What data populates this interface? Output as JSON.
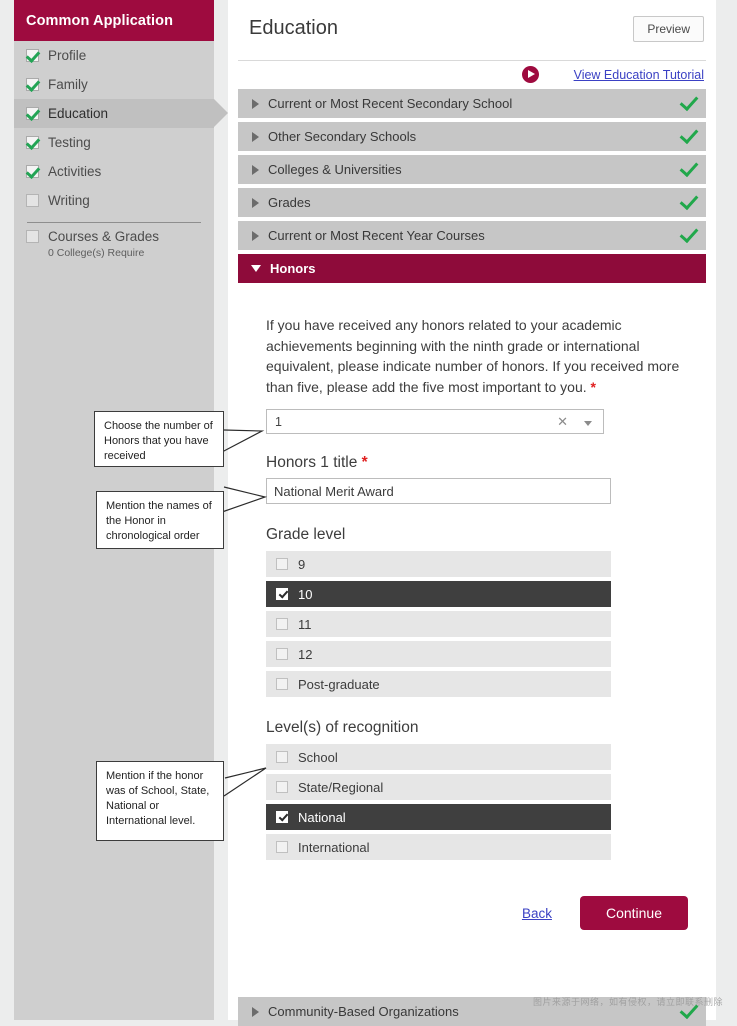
{
  "sidebar": {
    "brand": "Common Application",
    "items": [
      {
        "label": "Profile",
        "checked": true
      },
      {
        "label": "Family",
        "checked": true
      },
      {
        "label": "Education",
        "checked": true,
        "active": true
      },
      {
        "label": "Testing",
        "checked": true
      },
      {
        "label": "Activities",
        "checked": true
      },
      {
        "label": "Writing",
        "checked": false
      }
    ],
    "courses": {
      "label": "Courses & Grades",
      "sub": "0 College(s) Require",
      "checked": false
    }
  },
  "header": {
    "title": "Education",
    "preview_label": "Preview",
    "tutorial_link": "View Education Tutorial",
    "play_icon": "play-circle-icon"
  },
  "accordion": [
    {
      "label": "Current or Most Recent Secondary School",
      "complete": true,
      "open": false
    },
    {
      "label": "Other Secondary Schools",
      "complete": true,
      "open": false
    },
    {
      "label": "Colleges & Universities",
      "complete": true,
      "open": false
    },
    {
      "label": "Grades",
      "complete": true,
      "open": false
    },
    {
      "label": "Current or Most Recent Year Courses",
      "complete": true,
      "open": false
    },
    {
      "label": "Honors",
      "complete": false,
      "open": true
    }
  ],
  "bottom_accordion": {
    "label": "Community-Based Organizations",
    "complete": true
  },
  "honors": {
    "intro": "If you have received any honors related to your academic achievements beginning with the ninth grade or international equivalent, please indicate number of honors. If you received more than five, please add the five most important to you.",
    "intro_required_marker": "*",
    "count_select": {
      "value": "1",
      "clear_icon": "clear-x-icon",
      "caret_icon": "chevron-down-icon"
    },
    "title_label": "Honors 1 title",
    "title_required_marker": "*",
    "title_value": "National Merit Award",
    "grade_level_label": "Grade level",
    "grade_levels": [
      {
        "label": "9",
        "checked": false
      },
      {
        "label": "10",
        "checked": true
      },
      {
        "label": "11",
        "checked": false
      },
      {
        "label": "12",
        "checked": false
      },
      {
        "label": "Post-graduate",
        "checked": false
      }
    ],
    "recognition_label": "Level(s) of recognition",
    "recognition_levels": [
      {
        "label": "School",
        "checked": false
      },
      {
        "label": "State/Regional",
        "checked": false
      },
      {
        "label": "National",
        "checked": true
      },
      {
        "label": "International",
        "checked": false
      }
    ]
  },
  "actions": {
    "back_label": "Back",
    "continue_label": "Continue"
  },
  "annotations": [
    {
      "text": "Choose the number of Honors that you have received"
    },
    {
      "text": "Mention the names of the Honor in chronological order"
    },
    {
      "text": "Mention if the honor was of School, State, National or International level."
    }
  ],
  "watermark": "图片来源于网络，如有侵权，请立即联系删除",
  "colors": {
    "brand": "#9e0b3f",
    "accent_open": "#8e0b3a",
    "check_green": "#21a84b",
    "link": "#3b41c4",
    "selected_row": "#3f3f3f"
  }
}
